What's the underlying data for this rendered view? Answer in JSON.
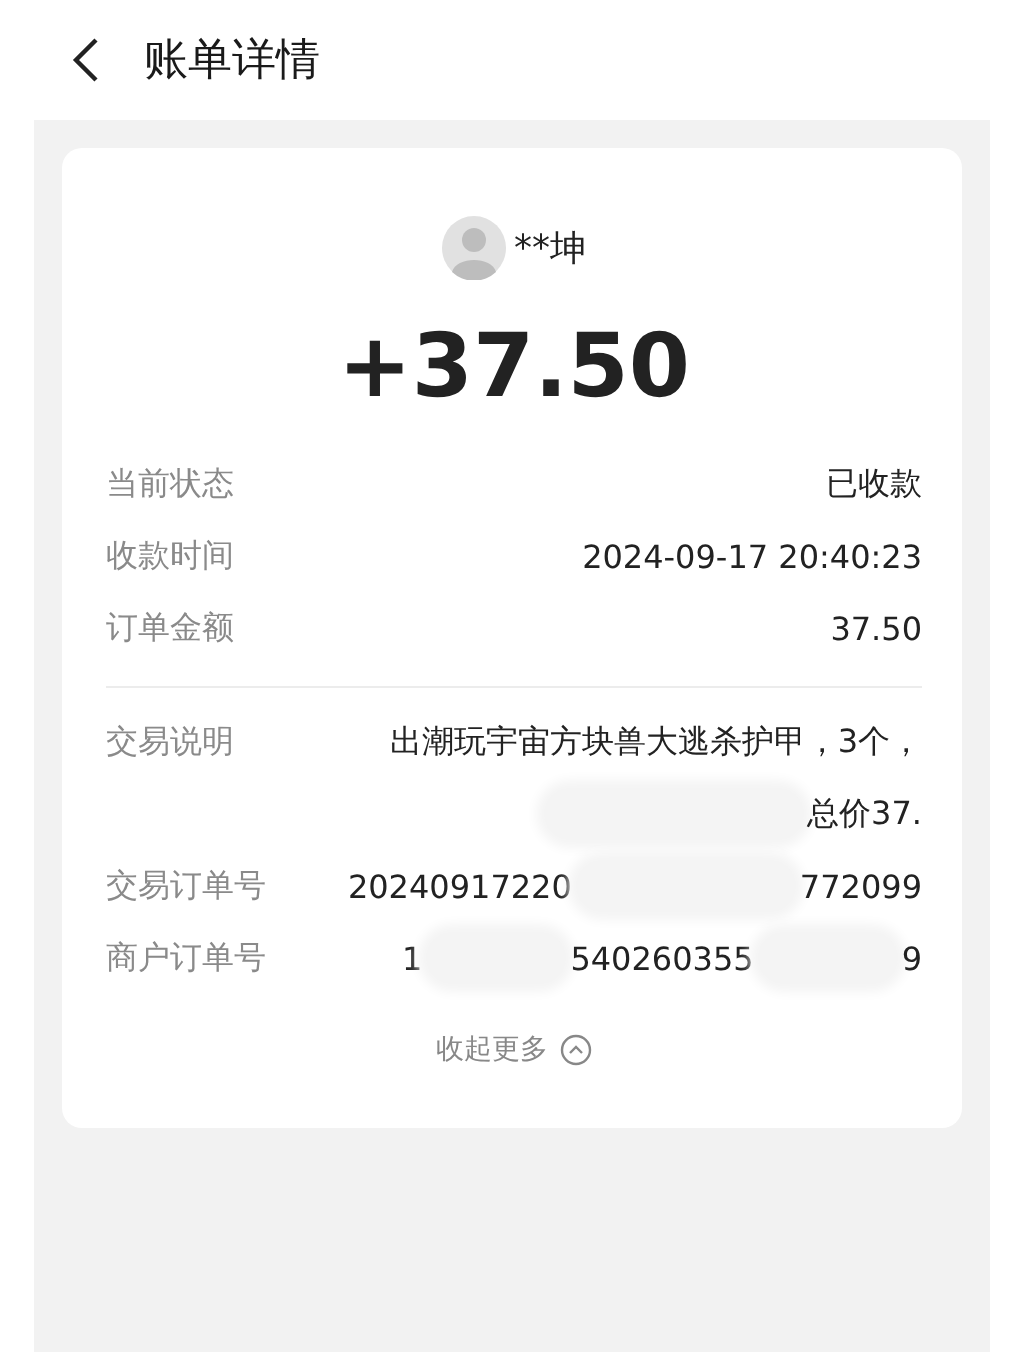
{
  "header": {
    "title": "账单详情"
  },
  "payer": {
    "name": "**坤"
  },
  "amount": "+37.50",
  "summary": [
    {
      "label": "当前状态",
      "value": "已收款"
    },
    {
      "label": "收款时间",
      "value": "2024-09-17 20:40:23"
    },
    {
      "label": "订单金额",
      "value": "37.50"
    }
  ],
  "description": {
    "label": "交易说明",
    "line_1": "出潮玩宇宙方块兽大逃杀护甲，3个，",
    "line_2": "总价37."
  },
  "ids": [
    {
      "label": "交易订单号",
      "parts": [
        "20240917220",
        "772099"
      ]
    },
    {
      "label": "商户订单号",
      "parts": [
        "1",
        "540260355",
        "9"
      ]
    }
  ],
  "collapse": {
    "label": "收起更多"
  }
}
